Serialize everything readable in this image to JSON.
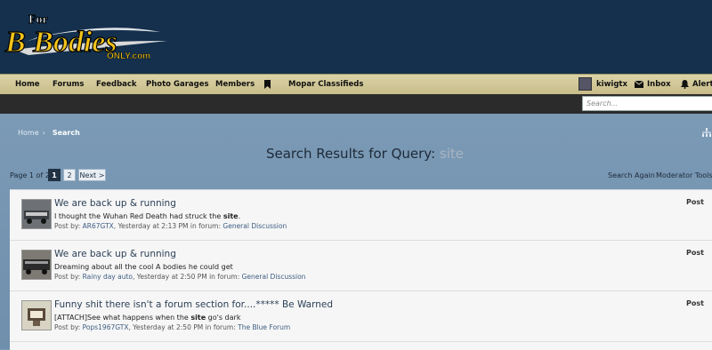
{
  "logo": {
    "text_top": "For",
    "text_main": "B Bodies",
    "text_sub": "ONLY.com"
  },
  "nav": {
    "items": [
      "Home",
      "Forums",
      "Feedback",
      "Photo Garages",
      "Members",
      "Mopar Classifieds"
    ],
    "bookmark_icon": "bookmark-icon",
    "username": "kiwigtx",
    "inbox": "Inbox",
    "alerts": "Alerts"
  },
  "search": {
    "placeholder": "Search..."
  },
  "breadcrumb": {
    "home": "Home",
    "sep": "›",
    "current": "Search"
  },
  "page": {
    "title_prefix": "Search Results for Query:",
    "query": "site"
  },
  "pager": {
    "label": "Page 1 of 2",
    "pages": [
      "1",
      "2"
    ],
    "next": "Next >"
  },
  "actions": {
    "search_again": "Search Again",
    "moderator_tools": "Moderator Tools ▾"
  },
  "results": [
    {
      "title": "We are back up & running",
      "snippet_before": "I thought the Wuhan Red Death had struck the ",
      "snippet_highlight": "site",
      "snippet_after": ".",
      "meta_prefix": "Post by: ",
      "author": "AR67GTX",
      "time": ", Yesterday at 2:13 PM in forum: ",
      "forum": "General Discussion",
      "type": "Post"
    },
    {
      "title": "We are back up & running",
      "snippet_before": "Dreaming about all the cool A bodies he could get",
      "snippet_highlight": "",
      "snippet_after": "",
      "meta_prefix": "Post by: ",
      "author": "Rainy day auto",
      "time": ", Yesterday at 2:50 PM in forum: ",
      "forum": "General Discussion",
      "type": "Post"
    },
    {
      "title": "Funny shit there isn't a forum section for....***** Be Warned",
      "snippet_before": "[ATTACH]See what happens when the ",
      "snippet_highlight": "site",
      "snippet_after": " go's dark",
      "meta_prefix": "Post by: ",
      "author": "Pops1967GTX",
      "time": ", Yesterday at 2:50 PM in forum: ",
      "forum": "The Blue Forum",
      "type": "Post"
    }
  ]
}
